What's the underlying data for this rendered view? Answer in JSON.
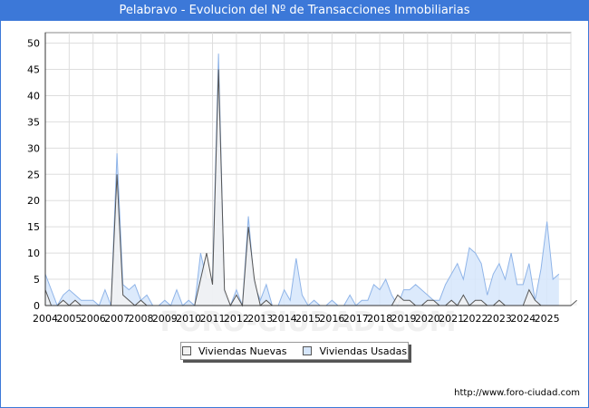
{
  "title": "Pelabravo - Evolucion del Nº de Transacciones Inmobiliarias",
  "footer_url": "http://www.foro-ciudad.com",
  "watermark": "FORO-CIUDAD.COM",
  "colors": {
    "title_bg": "#3c78d8",
    "nuevas_fill": "#f2f2f2",
    "nuevas_line": "#555555",
    "usadas_fill": "#d6e6fb",
    "usadas_line": "#8fb4e8",
    "grid": "#dddddd"
  },
  "chart_data": {
    "type": "area",
    "title": "Pelabravo - Evolucion del Nº de Transacciones Inmobiliarias",
    "xlabel": "",
    "ylabel": "",
    "ylim": [
      0,
      52
    ],
    "yticks": [
      0,
      5,
      10,
      15,
      20,
      25,
      30,
      35,
      40,
      45,
      50
    ],
    "grid": true,
    "legend_position": "bottom-center",
    "years": [
      "2004",
      "2005",
      "2006",
      "2007",
      "2008",
      "2009",
      "2010",
      "2011",
      "2012",
      "2013",
      "2014",
      "2015",
      "2016",
      "2017",
      "2018",
      "2019",
      "2020",
      "2021",
      "2022",
      "2023",
      "2024",
      "2025"
    ],
    "x_period": "quarterly",
    "series": [
      {
        "name": "Viviendas Nuevas",
        "values": [
          3,
          0,
          0,
          1,
          0,
          1,
          0,
          0,
          0,
          0,
          0,
          0,
          25,
          2,
          1,
          0,
          1,
          0,
          0,
          0,
          0,
          0,
          0,
          0,
          0,
          0,
          5,
          10,
          4,
          45,
          3,
          0,
          2,
          0,
          15,
          5,
          0,
          1,
          0,
          0,
          0,
          0,
          0,
          0,
          0,
          0,
          0,
          0,
          0,
          0,
          0,
          0,
          0,
          0,
          0,
          0,
          0,
          0,
          0,
          2,
          1,
          1,
          0,
          0,
          1,
          1,
          0,
          0,
          1,
          0,
          2,
          0,
          1,
          1,
          0,
          0,
          1,
          0,
          0,
          0,
          0,
          3,
          1,
          0,
          0,
          0,
          0,
          0,
          0,
          1
        ]
      },
      {
        "name": "Viviendas Usadas",
        "values": [
          6,
          3,
          0,
          2,
          3,
          2,
          1,
          1,
          1,
          0,
          3,
          0,
          29,
          4,
          3,
          4,
          1,
          2,
          0,
          0,
          1,
          0,
          3,
          0,
          1,
          0,
          10,
          5,
          5,
          48,
          2,
          0,
          3,
          0,
          17,
          4,
          1,
          4,
          0,
          0,
          3,
          1,
          9,
          2,
          0,
          1,
          0,
          0,
          1,
          0,
          0,
          2,
          0,
          1,
          1,
          4,
          3,
          5,
          2,
          0,
          3,
          3,
          4,
          3,
          2,
          1,
          1,
          4,
          6,
          8,
          5,
          11,
          10,
          8,
          2,
          6,
          8,
          5,
          10,
          4,
          4,
          8,
          1,
          7,
          16,
          5,
          6
        ]
      }
    ]
  }
}
